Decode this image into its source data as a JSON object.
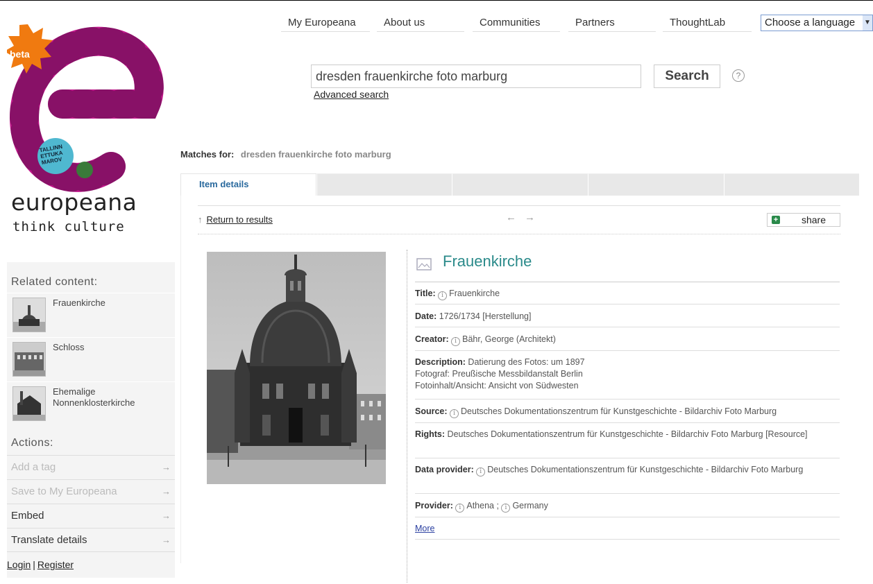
{
  "brand": {
    "name": "europeana",
    "tagline": "think culture",
    "badge": "beta",
    "logo_lettering": "TALLINN ETTUKA MAROV"
  },
  "nav": {
    "items": [
      "My Europeana",
      "About us",
      "Communities",
      "Partners",
      "ThoughtLab"
    ],
    "language_select": "Choose a language"
  },
  "search": {
    "query": "dresden frauenkirche foto marburg",
    "button": "Search",
    "help": "?",
    "advanced": "Advanced search"
  },
  "matches": {
    "label": "Matches for:",
    "query": "dresden frauenkirche foto marburg"
  },
  "tabs": {
    "active": "Item details"
  },
  "toolbar": {
    "return": "Return to results",
    "return_arrow": "↑",
    "prev": "←",
    "next": "→",
    "share": "share"
  },
  "item": {
    "title": "Frauenkirche",
    "fields": {
      "title": {
        "label": "Title:",
        "value": "Frauenkirche"
      },
      "date": {
        "label": "Date:",
        "value": "1726/1734 [Herstellung]"
      },
      "creator": {
        "label": "Creator:",
        "value": "Bähr, George (Architekt)"
      },
      "description": {
        "label": "Description:",
        "line1": "Datierung des Fotos: um 1897",
        "line2": "Fotograf: Preußische Messbildanstalt Berlin",
        "line3": "Fotoinhalt/Ansicht: Ansicht von Südwesten"
      },
      "source": {
        "label": "Source:",
        "value": "Deutsches Dokumentationszentrum für Kunstgeschichte - Bildarchiv Foto Marburg"
      },
      "rights": {
        "label": "Rights:",
        "value": "Deutsches Dokumentationszentrum für Kunstgeschichte - Bildarchiv Foto Marburg [Resource]"
      },
      "data_provider": {
        "label": "Data provider:",
        "value": "Deutsches Dokumentationszentrum für Kunstgeschichte - Bildarchiv Foto Marburg"
      },
      "provider": {
        "label": "Provider:",
        "value1": "Athena",
        "sep": ";",
        "value2": "Germany"
      }
    },
    "more": "More"
  },
  "sidebar": {
    "related_heading": "Related content:",
    "related": [
      {
        "label": "Frauenkirche"
      },
      {
        "label": "Schloss"
      },
      {
        "label": "Ehemalige Nonnenklosterkirche"
      }
    ],
    "actions_heading": "Actions:",
    "actions": [
      {
        "label": "Add a tag",
        "arrow": "→"
      },
      {
        "label": "Save to My Europeana",
        "arrow": "→"
      },
      {
        "label": "Embed",
        "arrow": "→"
      },
      {
        "label": "Translate details",
        "arrow": "→"
      }
    ],
    "login": "Login",
    "login_sep": "|",
    "register": "Register"
  },
  "colors": {
    "accent_teal": "#2a8a8a",
    "link_blue": "#2a3fa0",
    "logo_magenta": "#c0168a"
  }
}
